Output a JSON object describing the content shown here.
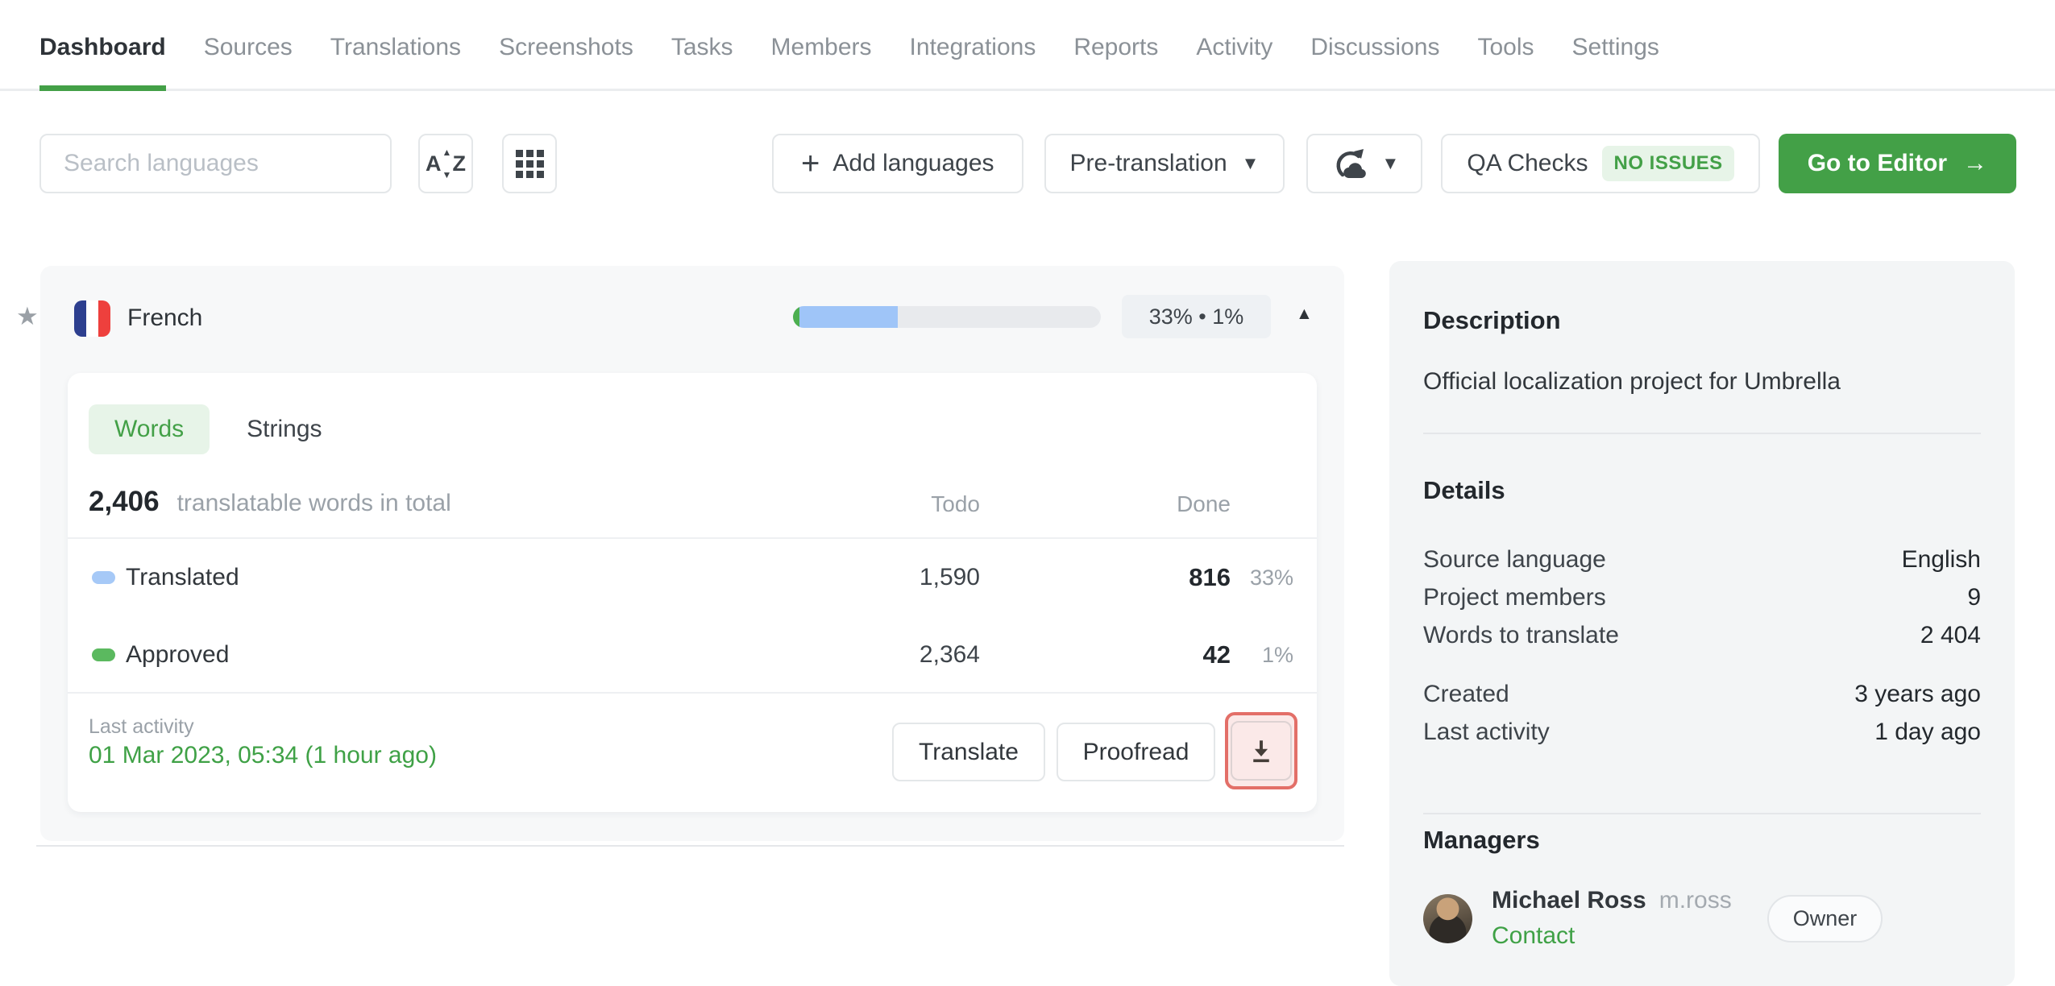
{
  "nav": {
    "items": [
      {
        "label": "Dashboard",
        "active": true
      },
      {
        "label": "Sources"
      },
      {
        "label": "Translations"
      },
      {
        "label": "Screenshots"
      },
      {
        "label": "Tasks"
      },
      {
        "label": "Members"
      },
      {
        "label": "Integrations"
      },
      {
        "label": "Reports"
      },
      {
        "label": "Activity"
      },
      {
        "label": "Discussions"
      },
      {
        "label": "Tools"
      },
      {
        "label": "Settings"
      }
    ]
  },
  "toolbar": {
    "search_placeholder": "Search languages",
    "add_languages": "Add languages",
    "pre_translation": "Pre-translation",
    "qa_checks": "QA Checks",
    "qa_badge": "NO ISSUES",
    "go_to_editor": "Go to Editor",
    "go_to_editor_arrow": "→"
  },
  "language": {
    "name": "French",
    "translated_pct": 32,
    "approved_pct": 2,
    "progress_label": "33% • 1%"
  },
  "card": {
    "tab_words": "Words",
    "tab_strings": "Strings",
    "total": "2,406",
    "total_caption": "translatable words in total",
    "col_todo": "Todo",
    "col_done": "Done",
    "rows": [
      {
        "label": "Translated",
        "color": "#a6c9f7",
        "todo": "1,590",
        "done": "816",
        "pct": "33%"
      },
      {
        "label": "Approved",
        "color": "#5bb95f",
        "todo": "2,364",
        "done": "42",
        "pct": "1%"
      }
    ],
    "last_activity_label": "Last activity",
    "last_activity_value": "01 Mar 2023, 05:34 (1 hour ago)",
    "translate": "Translate",
    "proofread": "Proofread"
  },
  "sidebar": {
    "description_title": "Description",
    "description_text": "Official localization project for Umbrella",
    "details_title": "Details",
    "details": [
      {
        "label": "Source language",
        "value": "English"
      },
      {
        "label": "Project members",
        "value": "9"
      },
      {
        "label": "Words to translate",
        "value": "2 404"
      }
    ],
    "details_dates": [
      {
        "label": "Created",
        "value": "3 years ago"
      },
      {
        "label": "Last activity",
        "value": "1 day ago"
      }
    ],
    "managers_title": "Managers",
    "manager": {
      "name": "Michael Ross",
      "username": "m.ross",
      "contact": "Contact",
      "badge": "Owner"
    }
  },
  "colors": {
    "brand_green": "#43a047",
    "translated_blue": "#a6c9f7",
    "approved_green": "#5bb95f",
    "highlight_red": "#e36f68"
  }
}
